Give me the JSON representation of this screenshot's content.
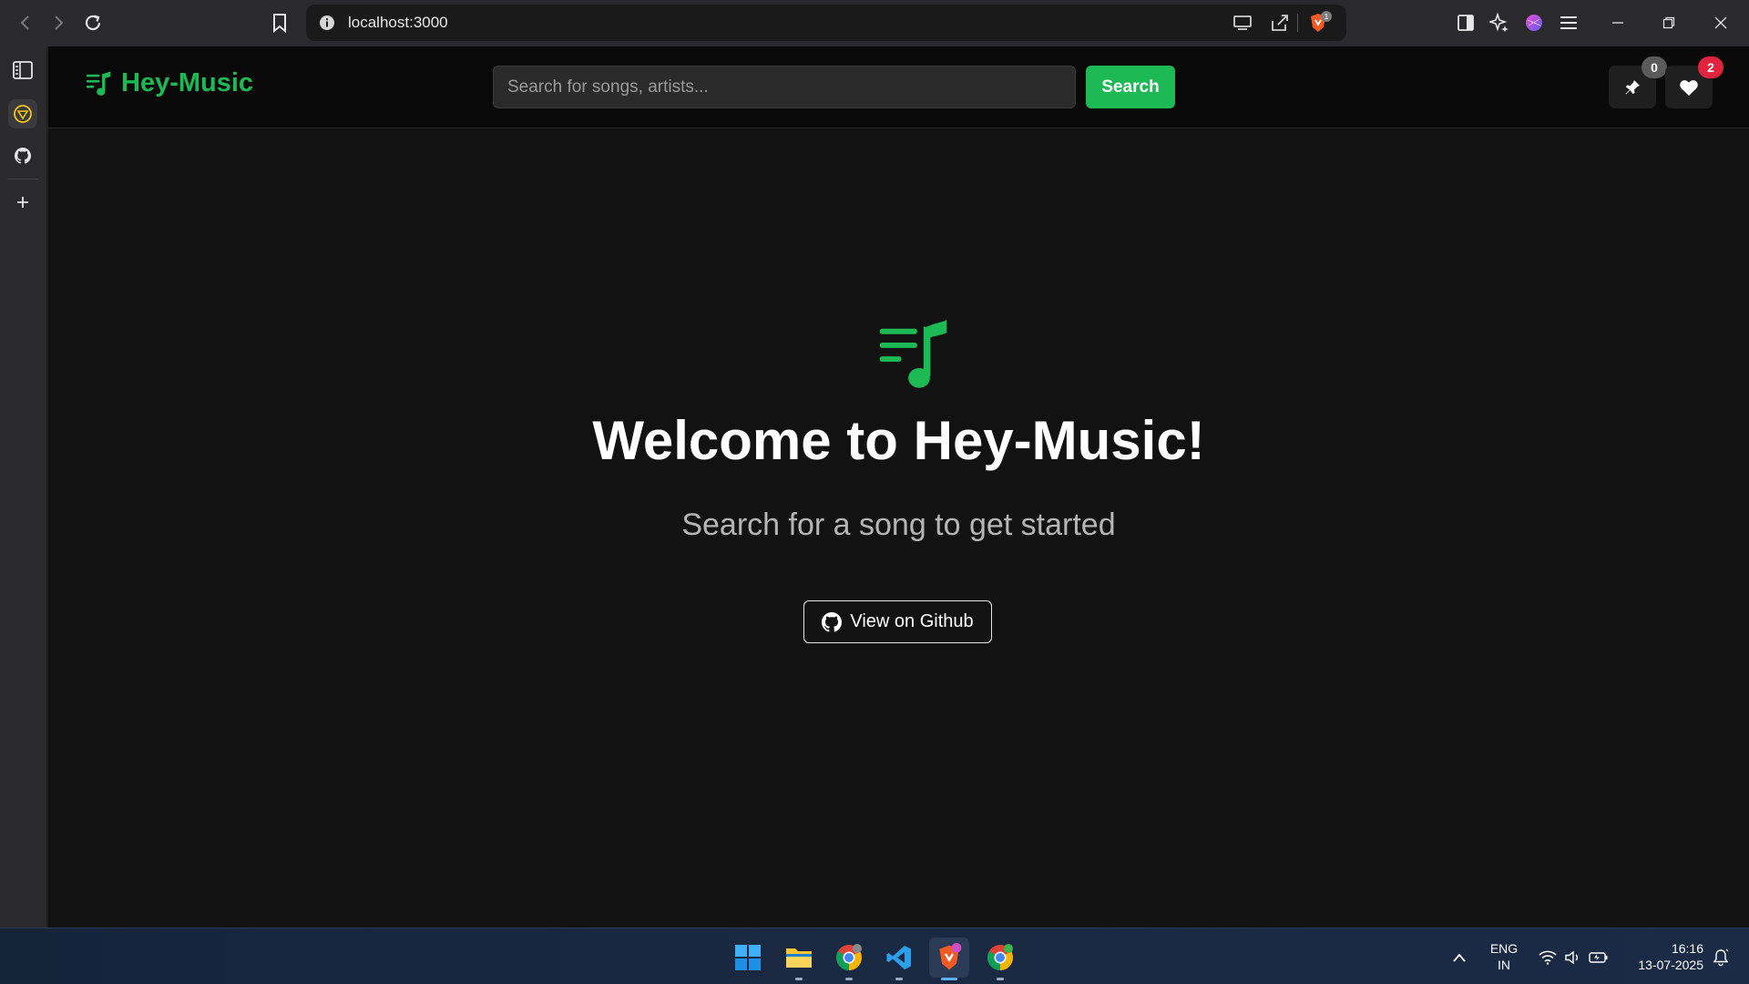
{
  "browser": {
    "url": "localhost:3000",
    "brave_badge": "1"
  },
  "app": {
    "brand": "Hey-Music",
    "search_placeholder": "Search for songs, artists...",
    "search_label": "Search",
    "pins_count": "0",
    "likes_count": "2",
    "accent_color": "#1db954",
    "likes_badge_color": "#e02440",
    "pins_badge_color": "#5a5a5a"
  },
  "hero": {
    "title": "Welcome to Hey-Music!",
    "subtitle": "Search for a song to get started",
    "github_label": "View on Github"
  },
  "taskbar": {
    "lang_line1": "ENG",
    "lang_line2": "IN",
    "time": "16:16",
    "date": "13-07-2025",
    "apps": [
      "windows-start-icon",
      "file-explorer-icon",
      "chrome-icon",
      "vscode-icon",
      "brave-icon",
      "chrome-icon"
    ]
  }
}
